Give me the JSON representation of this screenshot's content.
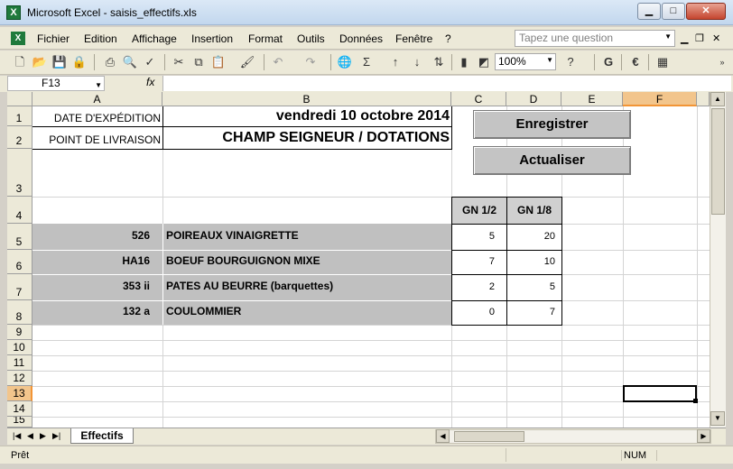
{
  "window": {
    "title": "Microsoft Excel - saisis_effectifs.xls",
    "min_label": "▁",
    "max_label": "□",
    "close_label": "✕"
  },
  "menu": {
    "items": [
      "Fichier",
      "Edition",
      "Affichage",
      "Insertion",
      "Format",
      "Outils",
      "Données",
      "Fenêtre",
      "?"
    ],
    "ask_placeholder": "Tapez une question"
  },
  "toolbar": {
    "zoom": "100%",
    "sigma": "Σ",
    "euro": "€",
    "bold": "G"
  },
  "formula_bar": {
    "name_box": "F13",
    "fx": "fx",
    "content": ""
  },
  "columns": [
    "A",
    "B",
    "C",
    "D",
    "E",
    "F"
  ],
  "rows": [
    "1",
    "2",
    "3",
    "4",
    "5",
    "6",
    "7",
    "8",
    "9",
    "10",
    "11",
    "12",
    "13",
    "14",
    "15"
  ],
  "cells": {
    "a1": "DATE D'EXPÉDITION",
    "b1": "vendredi 10 octobre 2014",
    "a2": "POINT DE LIVRAISON",
    "b2": "CHAMP SEIGNEUR / DOTATIONS",
    "c4": "GN 1/2",
    "d4": "GN 1/8",
    "items": [
      {
        "code": "526",
        "name": "POIREAUX VINAIGRETTE",
        "gn12": "5",
        "gn18": "20"
      },
      {
        "code": "HA16",
        "name": "BOEUF BOURGUIGNON MIXE",
        "gn12": "7",
        "gn18": "10"
      },
      {
        "code": "353 ii",
        "name": "PATES AU BEURRE (barquettes)",
        "gn12": "2",
        "gn18": "5"
      },
      {
        "code": "132 a",
        "name": "COULOMMIER",
        "gn12": "0",
        "gn18": "7"
      }
    ]
  },
  "buttons": {
    "save": "Enregistrer",
    "refresh": "Actualiser"
  },
  "sheet_tab": "Effectifs",
  "status": {
    "ready": "Prêt",
    "num": "NUM"
  },
  "colors": {
    "gray_fill": "#c0c0c0",
    "selection": "#f29536"
  }
}
